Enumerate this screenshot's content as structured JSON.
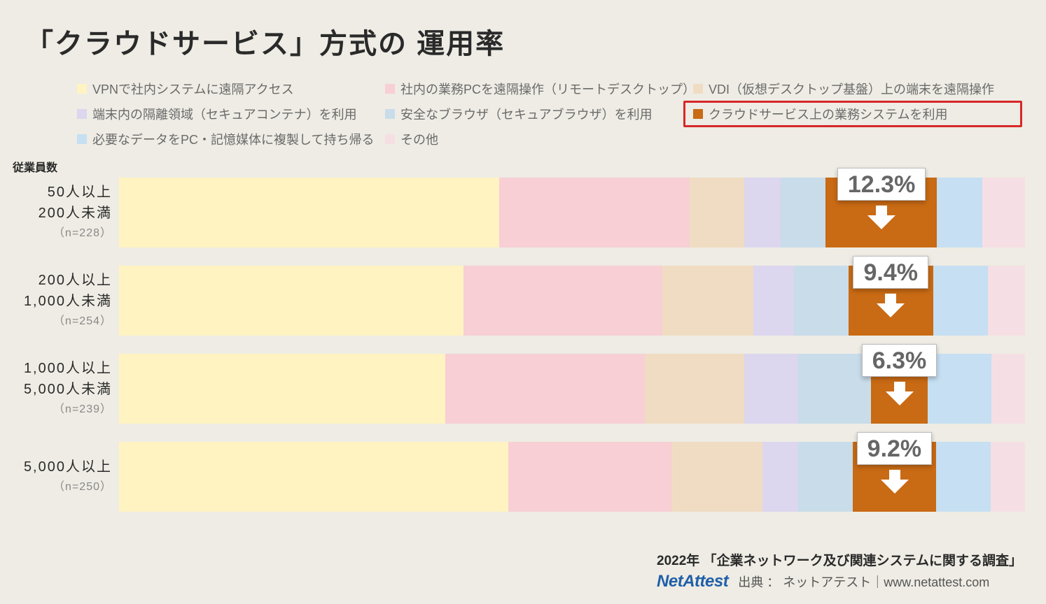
{
  "title": "「クラウドサービス」方式の 運用率",
  "axis_title": "従業員数",
  "legend": [
    {
      "label": "VPNで社内システムに遠隔アクセス",
      "color": "#fff3c2"
    },
    {
      "label": "社内の業務PCを遠隔操作（リモートデスクトップ）",
      "color": "#f7cfd4"
    },
    {
      "label": "VDI（仮想デスクトップ基盤）上の端末を遠隔操作",
      "color": "#f0dcc3"
    },
    {
      "label": "端末内の隔離領域（セキュアコンテナ）を利用",
      "color": "#dcd6ef"
    },
    {
      "label": "安全なブラウザ（セキュアブラウザ）を利用",
      "color": "#c9dcea"
    },
    {
      "label": "クラウドサービス上の業務システムを利用",
      "color": "#c96a14",
      "highlighted": true
    },
    {
      "label": "必要なデータをPC・記憶媒体に複製して持ち帰る",
      "color": "#c6dff2"
    },
    {
      "label": "その他",
      "color": "#f5dfe4"
    }
  ],
  "footer": {
    "survey": "2022年 「企業ネットワーク及び関連システムに関する調査」",
    "brand": "NetAttest",
    "credit": "出典 ： ネットアテスト｜www.netattest.com"
  },
  "chart_data": {
    "type": "bar",
    "orientation": "horizontal-stacked",
    "xlabel": "",
    "ylabel": "従業員数",
    "highlighted_series": "クラウドサービス上の業務システムを利用",
    "categories": [
      {
        "lines": [
          "50人以上",
          "200人未満"
        ],
        "n": "（n=228）"
      },
      {
        "lines": [
          "200人以上",
          "1,000人未満"
        ],
        "n": "（n=254）"
      },
      {
        "lines": [
          "1,000人以上",
          "5,000人未満"
        ],
        "n": "（n=239）"
      },
      {
        "lines": [
          "5,000人以上"
        ],
        "n": "（n=250）"
      }
    ],
    "series": [
      {
        "name": "VPNで社内システムに遠隔アクセス",
        "color": "#fff3c2",
        "values": [
          42.0,
          38.0,
          36.0,
          43.0
        ]
      },
      {
        "name": "社内の業務PCを遠隔操作（リモートデスクトップ）",
        "color": "#f7cfd4",
        "values": [
          21.0,
          22.0,
          22.0,
          18.0
        ]
      },
      {
        "name": "VDI（仮想デスクトップ基盤）上の端末を遠隔操作",
        "color": "#f0dcc3",
        "values": [
          6.0,
          10.0,
          11.0,
          10.0
        ]
      },
      {
        "name": "端末内の隔離領域（セキュアコンテナ）を利用",
        "color": "#dcd6ef",
        "values": [
          4.0,
          4.5,
          6.0,
          4.0
        ]
      },
      {
        "name": "安全なブラウザ（セキュアブラウザ）を利用",
        "color": "#c9dcea",
        "values": [
          5.0,
          6.0,
          8.0,
          6.0
        ]
      },
      {
        "name": "クラウドサービス上の業務システムを利用",
        "color": "#c96a14",
        "values": [
          12.3,
          9.4,
          6.3,
          9.2
        ]
      },
      {
        "name": "必要なデータをPC・記憶媒体に複製して持ち帰る",
        "color": "#c6dff2",
        "values": [
          5.0,
          6.0,
          7.0,
          6.0
        ]
      },
      {
        "name": "その他",
        "color": "#f5dfe4",
        "values": [
          4.7,
          4.1,
          3.7,
          3.8
        ]
      }
    ],
    "callouts": [
      "12.3%",
      "9.4%",
      "6.3%",
      "9.2%"
    ]
  }
}
